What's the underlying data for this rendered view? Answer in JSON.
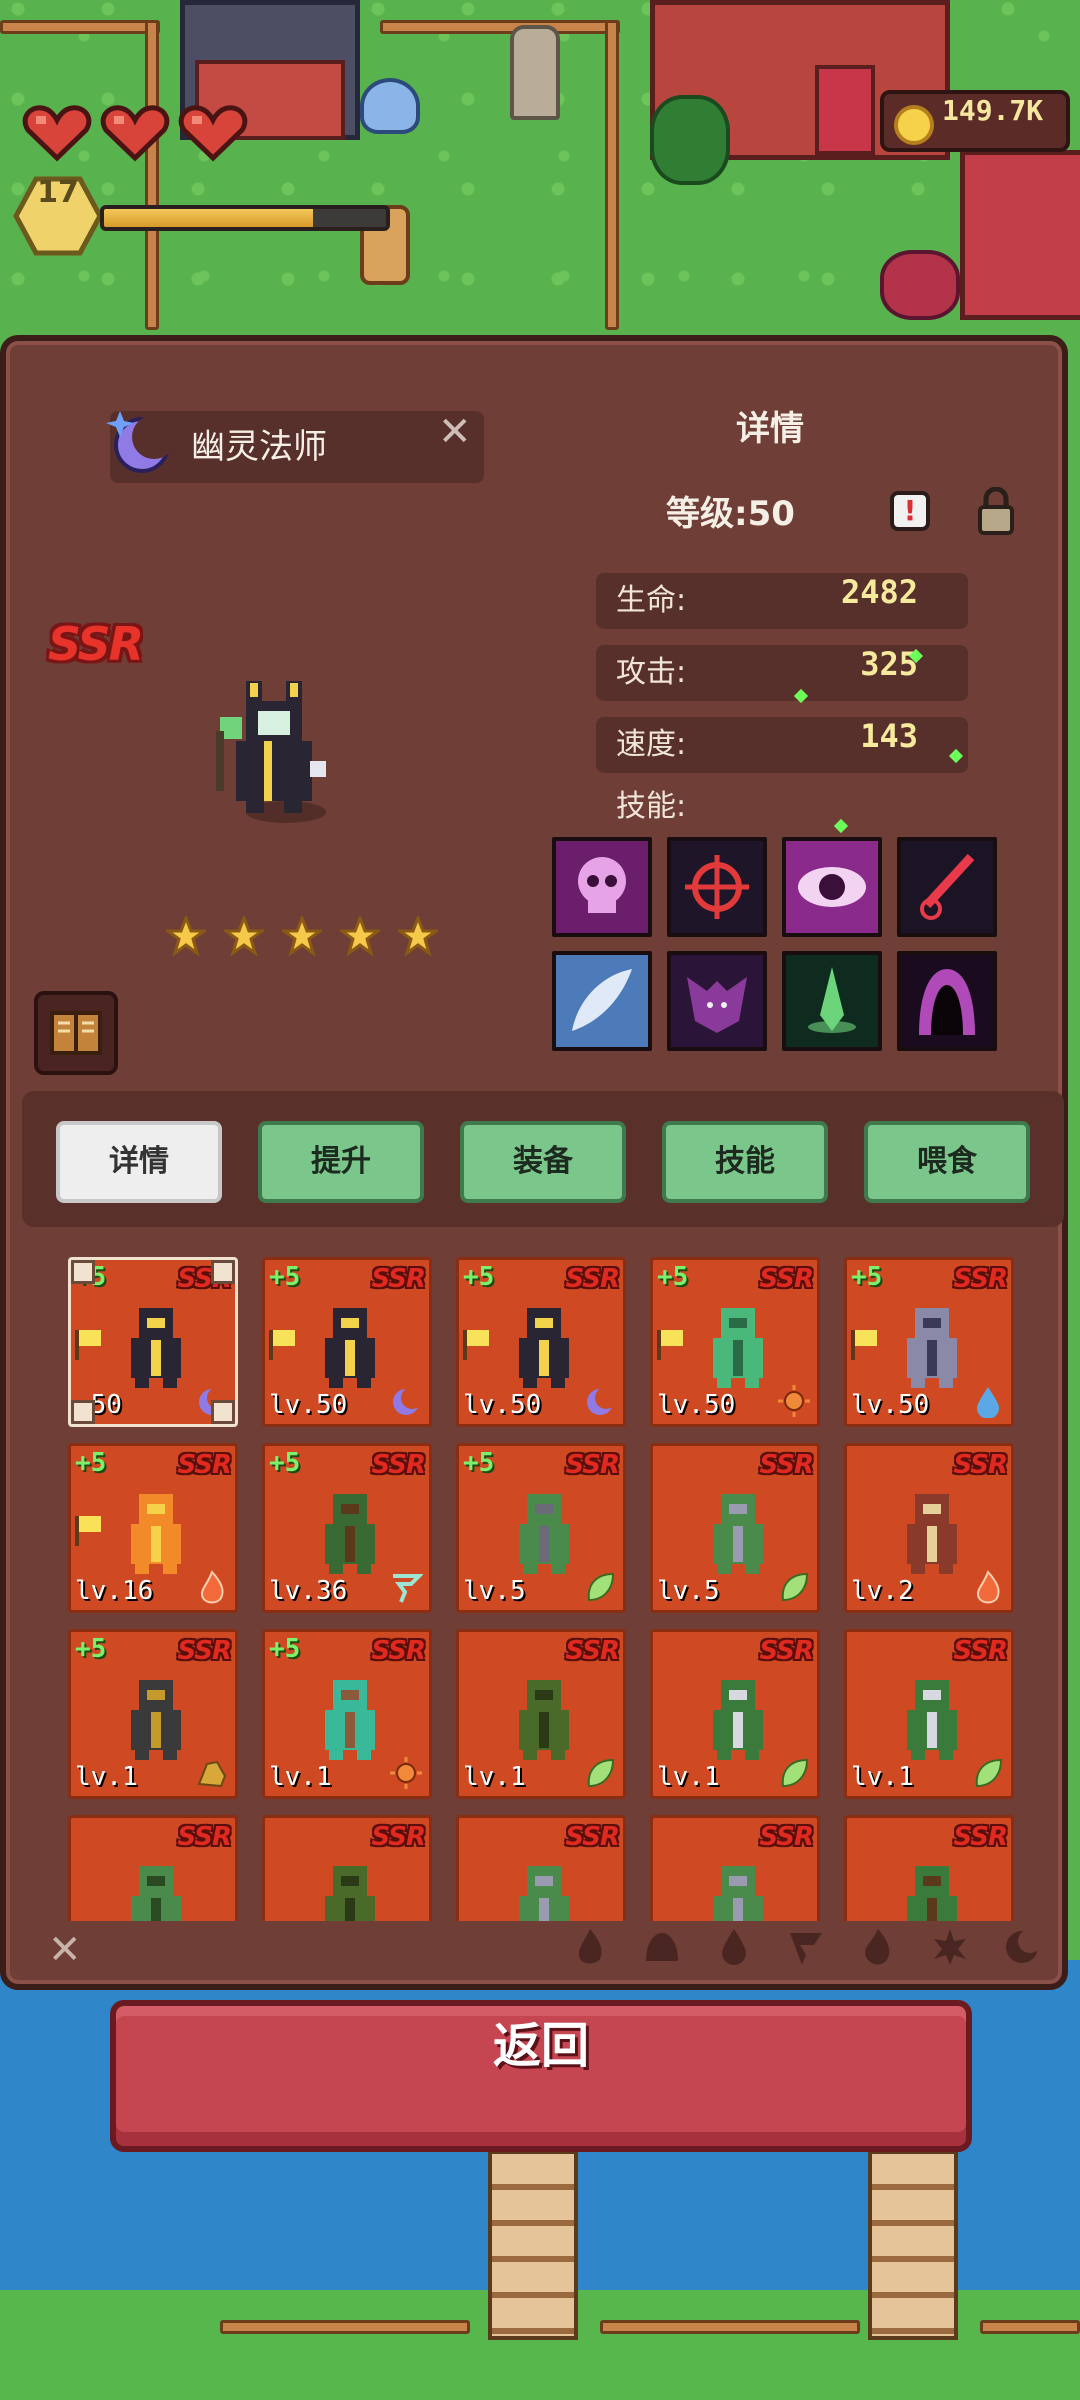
{
  "hud": {
    "hearts": 3,
    "player_level": "17",
    "xp_progress": 0.74,
    "coins": "149.7K"
  },
  "hero": {
    "name": "幽灵法师",
    "rarity": "SSR",
    "stars": 5,
    "tab_title": "详情",
    "level_text": "等级:50",
    "stats": [
      {
        "label": "生命:",
        "value": "2482"
      },
      {
        "label": "攻击:",
        "value": "325"
      },
      {
        "label": "速度:",
        "value": "143"
      }
    ],
    "skills_label": "技能:",
    "skills": [
      {
        "icon": "pink-skull-icon",
        "color": "#e6a3e6",
        "bg": "#6b1e6b"
      },
      {
        "icon": "crosshair-icon",
        "color": "#e23a3a",
        "bg": "#1e1628"
      },
      {
        "icon": "eye-icon",
        "color": "#f2d4f2",
        "bg": "#8a2a8a"
      },
      {
        "icon": "red-sword-icon",
        "color": "#e83a4a",
        "bg": "#1a1424"
      },
      {
        "icon": "feather-icon",
        "color": "#dfe9f8",
        "bg": "#4d7ab8"
      },
      {
        "icon": "bat-icon",
        "color": "#8a3a9a",
        "bg": "#2a1538"
      },
      {
        "icon": "green-spirit-icon",
        "color": "#6cd47a",
        "bg": "#0f2a1e"
      },
      {
        "icon": "shadow-portal-icon",
        "color": "#b04ab8",
        "bg": "#1a0c1e"
      }
    ]
  },
  "tabs": [
    {
      "label": "详情",
      "active": true
    },
    {
      "label": "提升",
      "active": false
    },
    {
      "label": "装备",
      "active": false
    },
    {
      "label": "技能",
      "active": false
    },
    {
      "label": "喂食",
      "active": false
    }
  ],
  "cards": [
    {
      "plus": "+5",
      "rarity": "SSR",
      "level": ".50",
      "flag": true,
      "element": "moon",
      "sprite": "ghost-mage",
      "selected": true
    },
    {
      "plus": "+5",
      "rarity": "SSR",
      "level": "lv.50",
      "flag": true,
      "element": "moon",
      "sprite": "ghost-mage"
    },
    {
      "plus": "+5",
      "rarity": "SSR",
      "level": "lv.50",
      "flag": true,
      "element": "moon",
      "sprite": "ghost-mage"
    },
    {
      "plus": "+5",
      "rarity": "SSR",
      "level": "lv.50",
      "flag": true,
      "element": "sun",
      "sprite": "green-slime"
    },
    {
      "plus": "+5",
      "rarity": "SSR",
      "level": "lv.50",
      "flag": true,
      "element": "water",
      "sprite": "grey-specter"
    },
    {
      "plus": "+5",
      "rarity": "SSR",
      "level": "lv.16",
      "flag": true,
      "element": "fire",
      "sprite": "fire-elemental"
    },
    {
      "plus": "+5",
      "rarity": "SSR",
      "level": "lv.36",
      "flag": false,
      "element": "wind",
      "sprite": "goblin-archer"
    },
    {
      "plus": "+5",
      "rarity": "SSR",
      "level": "lv.5",
      "flag": false,
      "element": "leaf",
      "sprite": "orc-knight"
    },
    {
      "plus": "",
      "rarity": "SSR",
      "level": "lv.5",
      "flag": false,
      "element": "leaf",
      "sprite": "goblin-rider"
    },
    {
      "plus": "",
      "rarity": "SSR",
      "level": "lv.2",
      "flag": false,
      "element": "fire",
      "sprite": "minotaur"
    },
    {
      "plus": "+5",
      "rarity": "SSR",
      "level": "lv.1",
      "flag": false,
      "element": "earth",
      "sprite": "rock-golem"
    },
    {
      "plus": "+5",
      "rarity": "SSR",
      "level": "lv.1",
      "flag": false,
      "element": "sun",
      "sprite": "deer-spirit"
    },
    {
      "plus": "",
      "rarity": "SSR",
      "level": "lv.1",
      "flag": false,
      "element": "leaf",
      "sprite": "treant"
    },
    {
      "plus": "",
      "rarity": "SSR",
      "level": "lv.1",
      "flag": false,
      "element": "leaf",
      "sprite": "orc-spearman"
    },
    {
      "plus": "",
      "rarity": "SSR",
      "level": "lv.1",
      "flag": false,
      "element": "leaf",
      "sprite": "orc-spearman"
    },
    {
      "plus": "",
      "rarity": "SSR",
      "level": "",
      "flag": false,
      "element": "",
      "sprite": "goblin"
    },
    {
      "plus": "",
      "rarity": "SSR",
      "level": "",
      "flag": false,
      "element": "",
      "sprite": "treant"
    },
    {
      "plus": "",
      "rarity": "SSR",
      "level": "",
      "flag": false,
      "element": "",
      "sprite": "goblin-rider"
    },
    {
      "plus": "",
      "rarity": "SSR",
      "level": "",
      "flag": false,
      "element": "",
      "sprite": "goblin-rider"
    },
    {
      "plus": "",
      "rarity": "SSR",
      "level": "",
      "flag": false,
      "element": "",
      "sprite": "orc"
    }
  ],
  "filters": [
    "fire-filter-icon",
    "earth-filter-icon",
    "water-filter-icon",
    "wind-filter-icon",
    "flame-filter-icon",
    "sun-filter-icon",
    "moon-filter-icon"
  ],
  "back_button": "返回",
  "colors": {
    "panel": "#6f3e36",
    "tab_green": "#7bc68b",
    "card_orange": "#cf4a22",
    "back_red": "#c54550"
  }
}
